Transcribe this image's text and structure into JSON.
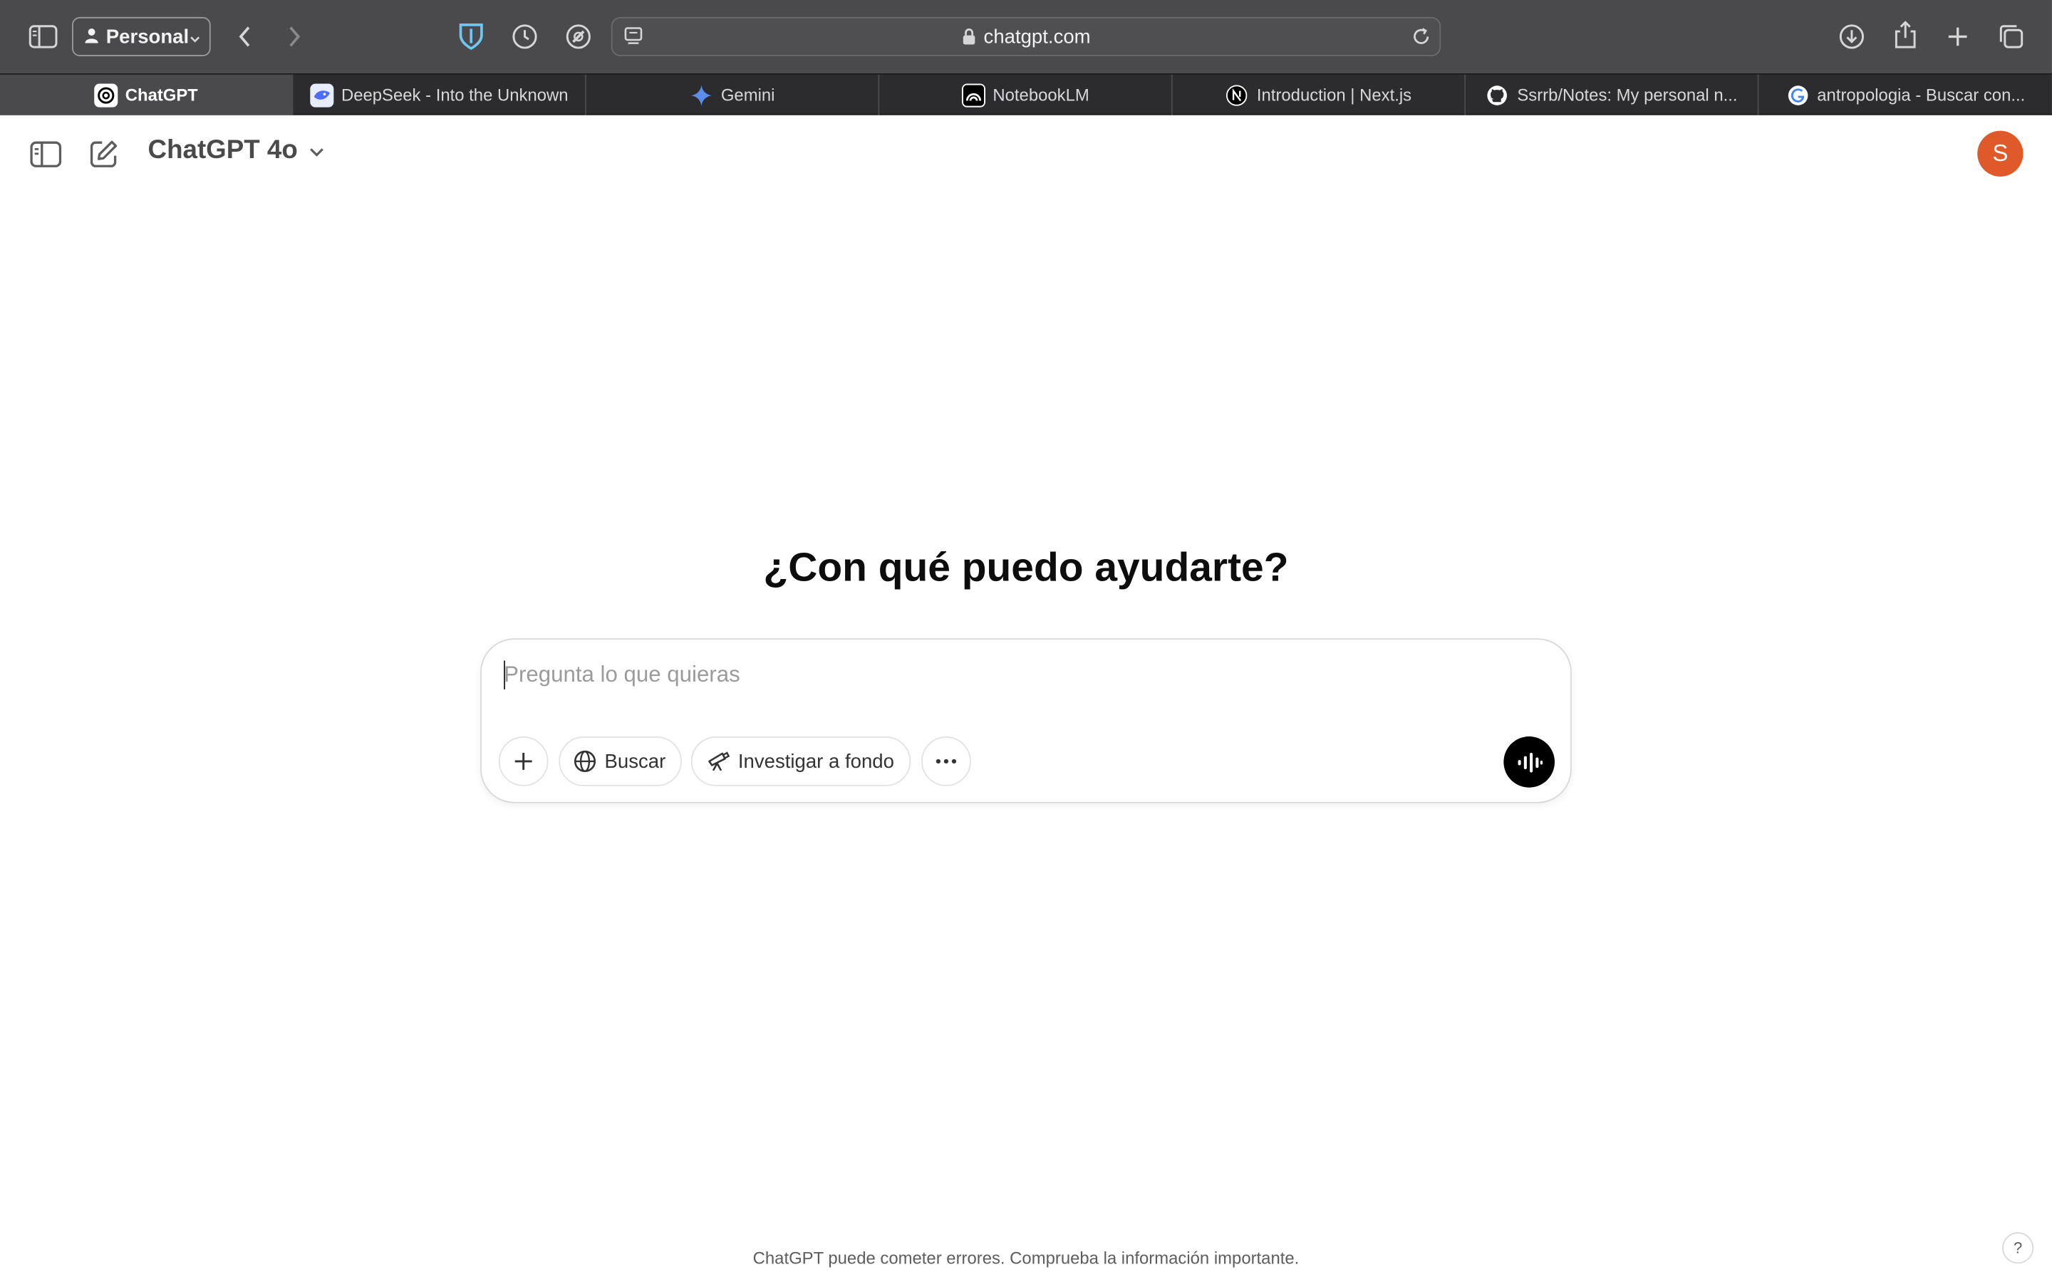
{
  "browser": {
    "profile_label": "Personal",
    "url": "chatgpt.com",
    "tabs": [
      {
        "title": "ChatGPT",
        "icon": "chatgpt-logo-icon",
        "active": true
      },
      {
        "title": "DeepSeek - Into the Unknown",
        "icon": "deepseek-logo-icon",
        "active": false
      },
      {
        "title": "Gemini",
        "icon": "gemini-sparkle-icon",
        "active": false
      },
      {
        "title": "NotebookLM",
        "icon": "notebooklm-logo-icon",
        "active": false
      },
      {
        "title": "Introduction | Next.js",
        "icon": "nextjs-logo-icon",
        "active": false
      },
      {
        "title": "Ssrrb/Notes: My personal n...",
        "icon": "github-logo-icon",
        "active": false
      },
      {
        "title": "antropologia - Buscar con...",
        "icon": "google-logo-icon",
        "active": false
      }
    ]
  },
  "chat": {
    "model_label": "ChatGPT 4o",
    "avatar_initial": "S",
    "headline": "¿Con qué puedo ayudarte?",
    "input_placeholder": "Pregunta lo que quieras",
    "search_label": "Buscar",
    "deep_research_label": "Investigar a fondo",
    "disclaimer": "ChatGPT puede cometer errores. Comprueba la información importante.",
    "help_label": "?"
  },
  "colors": {
    "toolbar_bg": "#4a4a4c",
    "tabbar_bg": "#2c2c2e",
    "avatar_bg": "#e0592a",
    "voice_button_bg": "#000000"
  }
}
